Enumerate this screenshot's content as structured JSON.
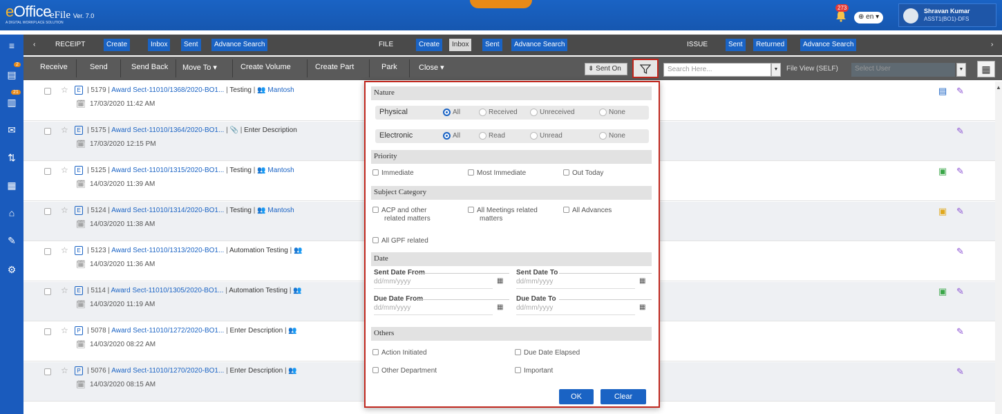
{
  "header": {
    "logo_text": "eOffice",
    "logo_tagline": "A DIGITAL WORKPLACE SOLUTION",
    "app_title": "eFile",
    "version": "Ver. 7.0",
    "notification_count": "273",
    "language": "en",
    "user_name": "Shravan Kumar",
    "user_role": "ASST1(BO1)-DFS"
  },
  "sidebar": {
    "items": [
      {
        "name": "receipt-icon",
        "badge": "2"
      },
      {
        "name": "file-icon",
        "badge": "21"
      },
      {
        "name": "dak-icon",
        "badge": ""
      },
      {
        "name": "movement-icon",
        "badge": ""
      },
      {
        "name": "reports-icon",
        "badge": ""
      },
      {
        "name": "home-icon",
        "badge": ""
      },
      {
        "name": "notes-icon",
        "badge": ""
      },
      {
        "name": "settings-icon",
        "badge": ""
      }
    ]
  },
  "nav": {
    "receipt_label": "RECEIPT",
    "receipt_create": "Create",
    "receipt_inbox": "Inbox",
    "receipt_sent": "Sent",
    "receipt_advsearch": "Advance Search",
    "file_label": "FILE",
    "file_create": "Create",
    "file_inbox": "Inbox",
    "file_sent": "Sent",
    "file_advsearch": "Advance Search",
    "issue_label": "ISSUE",
    "issue_sent": "Sent",
    "issue_returned": "Returned",
    "issue_advsearch": "Advance Search"
  },
  "actions": {
    "receive": "Receive",
    "send": "Send",
    "send_back": "Send Back",
    "move_to": "Move To ▾",
    "create_volume": "Create Volume",
    "create_part": "Create Part",
    "park": "Park",
    "close": "Close ▾",
    "sent_on": "Sent On",
    "search_placeholder": "Search Here...",
    "file_view": "File View (SELF)",
    "select_user": "Select User"
  },
  "rows": [
    {
      "type": "E",
      "id": "5179",
      "file_no": "Award Sect-11010/1368/2020-BO1...",
      "subject": "Testing",
      "sender": "Mantosh",
      "date": "17/03/2020 11:42 AM",
      "attachment": false,
      "doc_icon": "note-icon"
    },
    {
      "type": "E",
      "id": "5175",
      "file_no": "Award Sect-11010/1364/2020-BO1...",
      "subject": "Enter Description",
      "sender": "",
      "date": "17/03/2020 12:15 PM",
      "attachment": true,
      "doc_icon": ""
    },
    {
      "type": "E",
      "id": "5125",
      "file_no": "Award Sect-11010/1315/2020-BO1...",
      "subject": "Testing",
      "sender": "Mantosh",
      "date": "14/03/2020 11:39 AM",
      "attachment": false,
      "doc_icon": "green-doc-icon"
    },
    {
      "type": "E",
      "id": "5124",
      "file_no": "Award Sect-11010/1314/2020-BO1...",
      "subject": "Testing",
      "sender": "Mantosh",
      "date": "14/03/2020 11:38 AM",
      "attachment": false,
      "doc_icon": "yellow-doc-icon"
    },
    {
      "type": "E",
      "id": "5123",
      "file_no": "Award Sect-11010/1313/2020-BO1...",
      "subject": "Automation Testing",
      "sender": "",
      "date": "14/03/2020 11:36 AM",
      "attachment": false,
      "doc_icon": ""
    },
    {
      "type": "E",
      "id": "5114",
      "file_no": "Award Sect-11010/1305/2020-BO1...",
      "subject": "Automation Testing",
      "sender": "",
      "date": "14/03/2020 11:19 AM",
      "attachment": false,
      "doc_icon": "green-doc-icon"
    },
    {
      "type": "P",
      "id": "5078",
      "file_no": "Award Sect-11010/1272/2020-BO1...",
      "subject": "Enter Description",
      "sender": "",
      "date": "14/03/2020 08:22 AM",
      "attachment": false,
      "doc_icon": ""
    },
    {
      "type": "P",
      "id": "5076",
      "file_no": "Award Sect-11010/1270/2020-BO1...",
      "subject": "Enter Description",
      "sender": "",
      "date": "14/03/2020 08:15 AM",
      "attachment": false,
      "doc_icon": ""
    }
  ],
  "filter": {
    "nature_title": "Nature",
    "physical_label": "Physical",
    "physical_options": [
      "All",
      "Received",
      "Unreceived",
      "None"
    ],
    "physical_selected": "All",
    "electronic_label": "Electronic",
    "electronic_options": [
      "All",
      "Read",
      "Unread",
      "None"
    ],
    "electronic_selected": "All",
    "priority_title": "Priority",
    "priority_options": [
      "Immediate",
      "Most Immediate",
      "Out Today"
    ],
    "subject_title": "Subject Category",
    "subject_opt1_a": "ACP and other",
    "subject_opt1_b": "related matters",
    "subject_opt2_a": "All Meetings related",
    "subject_opt2_b": "matters",
    "subject_opt3": "All Advances",
    "subject_opt4": "All GPF related",
    "date_title": "Date",
    "sent_from_label": "Sent Date From",
    "sent_to_label": "Sent Date To",
    "due_from_label": "Due Date From",
    "due_to_label": "Due Date To",
    "date_placeholder": "dd/mm/yyyy",
    "others_title": "Others",
    "others_options": [
      "Action Initiated",
      "Due Date Elapsed",
      "Other Department",
      "Important"
    ],
    "ok_label": "OK",
    "clear_label": "Clear"
  },
  "colors": {
    "brand_blue": "#1a63c4",
    "accent_red": "#c0271e",
    "orange": "#e98a17"
  }
}
